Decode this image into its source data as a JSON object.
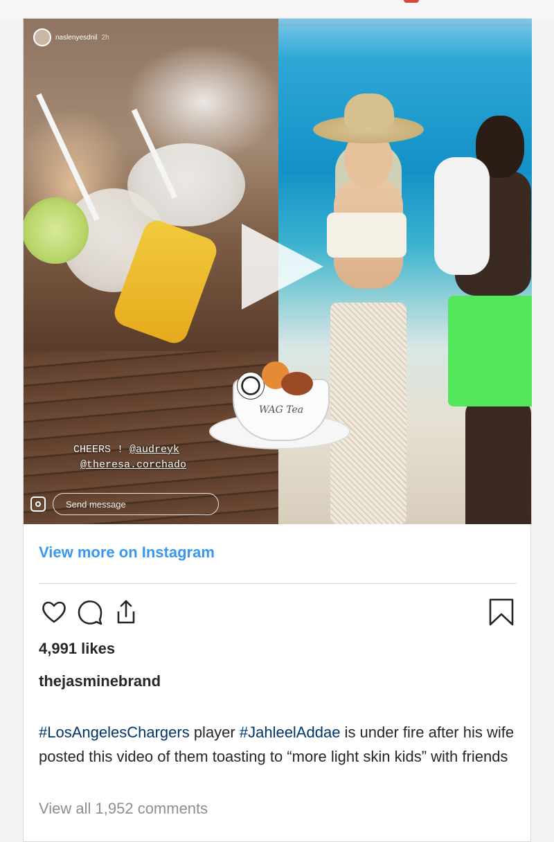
{
  "story": {
    "username": "naslenyesdnil",
    "time": "2h",
    "caption_line1_prefix": "CHEERS ! ",
    "caption_line1_tag": "@audreyk",
    "caption_line2_tag": "@theresa.corchado",
    "send_placeholder": "Send message"
  },
  "sticker": {
    "text": "WAG Tea"
  },
  "post": {
    "view_more": "View more on Instagram",
    "likes": "4,991 likes",
    "username": "thejasminebrand",
    "caption": {
      "hashtag1": "#LosAngelesChargers",
      "text1": " player ",
      "hashtag2": "#JahleelAddae",
      "text2": " is under fire after his wife posted this video of them toasting to “more light skin kids” with friends"
    },
    "comments": "View all 1,952 comments"
  },
  "colors": {
    "link": "#3897f0",
    "hashtag": "#003569",
    "text": "#262626",
    "muted": "#8e8e8e"
  },
  "icons": [
    "heart-icon",
    "comment-icon",
    "share-icon",
    "bookmark-icon",
    "play-icon",
    "camera-icon"
  ]
}
